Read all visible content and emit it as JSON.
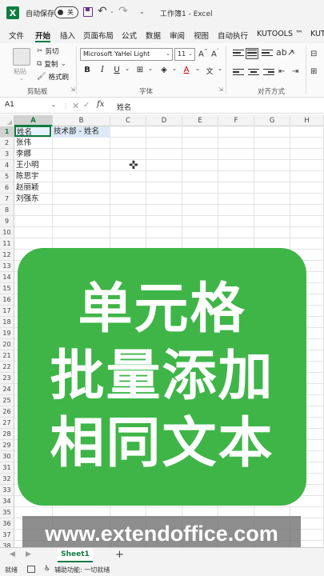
{
  "titlebar": {
    "autosave_label": "自动保存",
    "autosave_state": "关",
    "doc_title": "工作簿1 - Excel"
  },
  "menu": {
    "tabs": [
      "文件",
      "开始",
      "插入",
      "页面布局",
      "公式",
      "数据",
      "审阅",
      "视图",
      "自动执行",
      "KUTOOLS ™",
      "KUT"
    ]
  },
  "ribbon": {
    "clipboard": {
      "paste": "粘贴",
      "cut": "剪切",
      "copy": "复制",
      "format_painter": "格式刷",
      "group_label": "剪贴板"
    },
    "font": {
      "font_name": "Microsoft YaHei Light",
      "font_size": "11",
      "group_label": "字体"
    },
    "alignment": {
      "group_label": "对齐方式"
    }
  },
  "formula_bar": {
    "name_box": "A1",
    "value": "姓名"
  },
  "grid": {
    "columns": [
      "A",
      "B",
      "C",
      "D",
      "E",
      "F",
      "G",
      "H"
    ],
    "rows": [
      "1",
      "2",
      "3",
      "4",
      "5",
      "6",
      "7",
      "8",
      "9",
      "10",
      "11",
      "12",
      "13",
      "14",
      "15",
      "16",
      "17",
      "18",
      "19",
      "20",
      "21",
      "22",
      "23",
      "24",
      "25",
      "26",
      "27",
      "28",
      "29",
      "30",
      "31",
      "32",
      "33",
      "34",
      "35",
      "36",
      "37",
      "38"
    ],
    "cells": {
      "A1": "姓名",
      "B1": "技术部 - 姓名",
      "A2": "张伟",
      "A3": "李娜",
      "A4": "王小明",
      "A5": "陈思宇",
      "A6": "赵丽颖",
      "A7": "刘强东"
    }
  },
  "overlay": {
    "lines": [
      "单元格",
      "批量添加",
      "相同文本"
    ],
    "url": "www.extendoffice.com",
    "card_color": "#3fb548"
  },
  "sheets": {
    "tabs": [
      "Sheet1"
    ],
    "add": "+"
  },
  "status": {
    "ready": "就绪",
    "accessibility": "辅助功能: 一切就绪"
  }
}
